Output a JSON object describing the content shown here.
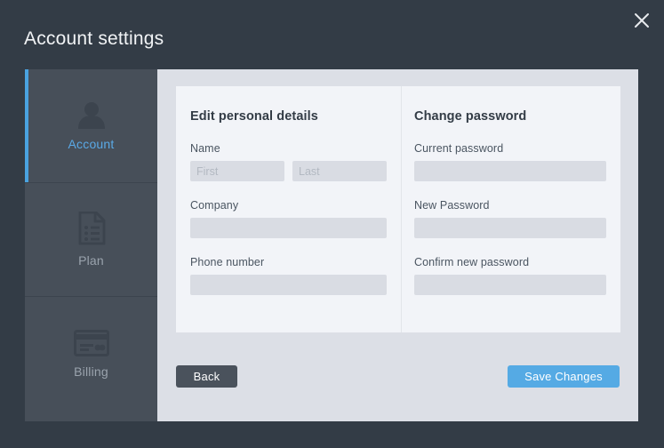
{
  "window": {
    "title": "Account settings",
    "close_icon": "close-icon"
  },
  "sidebar": {
    "items": [
      {
        "label": "Account",
        "icon": "person-icon",
        "active": true
      },
      {
        "label": "Plan",
        "icon": "document-icon",
        "active": false
      },
      {
        "label": "Billing",
        "icon": "credit-card-icon",
        "active": false
      }
    ]
  },
  "form": {
    "personal": {
      "heading": "Edit personal details",
      "name_label": "Name",
      "first_placeholder": "First",
      "first_value": "",
      "last_placeholder": "Last",
      "last_value": "",
      "company_label": "Company",
      "company_placeholder": "",
      "company_value": "",
      "phone_label": "Phone number",
      "phone_placeholder": "",
      "phone_value": ""
    },
    "password": {
      "heading": "Change password",
      "current_label": "Current password",
      "current_placeholder": "",
      "current_value": "",
      "new_label": "New Password",
      "new_placeholder": "",
      "new_value": "",
      "confirm_label": "Confirm new password",
      "confirm_placeholder": "",
      "confirm_value": ""
    }
  },
  "footer": {
    "back_label": "Back",
    "save_label": "Save Changes"
  },
  "colors": {
    "window_background": "#333c46",
    "sidebar_background": "#474f59",
    "panel_background": "#dcdfe6",
    "card_background": "#f2f4f8",
    "accent_blue": "#4aa3e0",
    "active_label_blue": "#5aa9e6",
    "input_background": "#d9dce3",
    "back_button": "#4a525c",
    "save_button": "#55aae4"
  }
}
